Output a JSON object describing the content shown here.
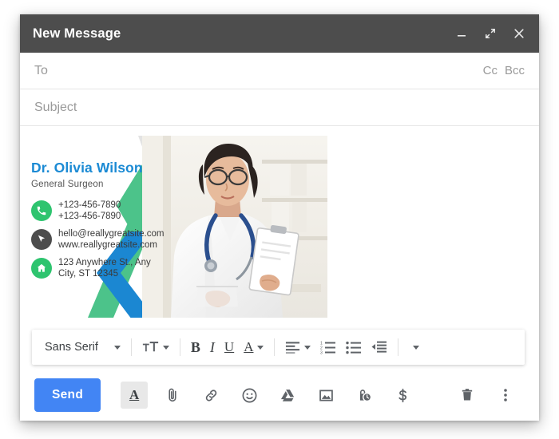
{
  "window": {
    "title": "New Message",
    "controls": [
      {
        "name": "minimize-button",
        "icon": "minimize-icon"
      },
      {
        "name": "expand-button",
        "icon": "expand-diagonal-icon"
      },
      {
        "name": "close-button",
        "icon": "close-icon"
      }
    ]
  },
  "fields": {
    "to": {
      "label": "To",
      "value": "",
      "placeholder": "To"
    },
    "subject": {
      "label": "Subject",
      "value": "",
      "placeholder": "Subject"
    },
    "cc": "Cc",
    "bcc": "Bcc"
  },
  "signature": {
    "name": "Dr. Olivia Wilson",
    "role": "General Surgeon",
    "name_color": "#1b8ad4",
    "accent_green": "#2ec46f",
    "accent_blue": "#1b8ad4",
    "contacts": [
      {
        "icon": "phone-icon",
        "icon_style": "green",
        "line1": "+123-456-7890",
        "line2": "+123-456-7890"
      },
      {
        "icon": "cursor-icon",
        "icon_style": "dark",
        "line1": "hello@reallygreatsite.com",
        "line2": "www.reallygreatsite.com"
      },
      {
        "icon": "home-icon",
        "icon_style": "green",
        "line1": "123 Anywhere St., Any",
        "line2": "City, ST 12345"
      }
    ],
    "photo_alt": "doctor-portrait"
  },
  "format_toolbar": {
    "font": "Sans Serif",
    "items": [
      {
        "name": "font-family-selector",
        "label": "Sans Serif",
        "icon": "chevron-down-icon"
      },
      {
        "name": "font-size-button",
        "icon": "font-size-icon"
      },
      {
        "name": "bold-button",
        "icon": "bold-icon",
        "label": "B"
      },
      {
        "name": "italic-button",
        "icon": "italic-icon",
        "label": "I"
      },
      {
        "name": "underline-button",
        "icon": "underline-icon",
        "label": "U"
      },
      {
        "name": "text-color-button",
        "icon": "text-color-icon",
        "label": "A"
      },
      {
        "name": "align-button",
        "icon": "align-left-icon"
      },
      {
        "name": "numbered-list-button",
        "icon": "numbered-list-icon"
      },
      {
        "name": "bulleted-list-button",
        "icon": "bulleted-list-icon"
      },
      {
        "name": "indent-less-button",
        "icon": "indent-decrease-icon"
      },
      {
        "name": "more-format-button",
        "icon": "chevron-down-icon"
      }
    ]
  },
  "action_bar": {
    "send_label": "Send",
    "send_color": "#4285f4",
    "icons": [
      {
        "name": "formatting-options-button",
        "icon": "text-format-icon",
        "active": true
      },
      {
        "name": "attach-file-button",
        "icon": "paperclip-icon",
        "active": false
      },
      {
        "name": "insert-link-button",
        "icon": "link-icon",
        "active": false
      },
      {
        "name": "insert-emoji-button",
        "icon": "emoji-icon",
        "active": false
      },
      {
        "name": "insert-drive-button",
        "icon": "google-drive-icon",
        "active": false
      },
      {
        "name": "insert-photo-button",
        "icon": "image-icon",
        "active": false
      },
      {
        "name": "confidential-mode-button",
        "icon": "lock-clock-icon",
        "active": false
      },
      {
        "name": "insert-money-button",
        "icon": "dollar-icon",
        "active": false
      }
    ],
    "right_icons": [
      {
        "name": "discard-draft-button",
        "icon": "trash-icon"
      },
      {
        "name": "more-options-button",
        "icon": "kebab-menu-icon"
      }
    ]
  }
}
